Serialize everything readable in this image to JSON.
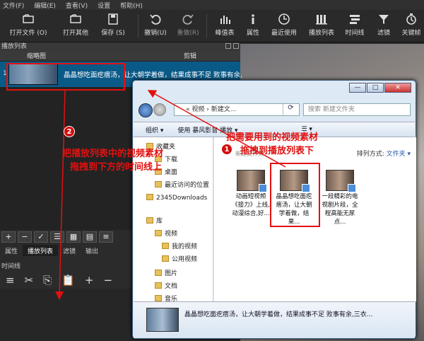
{
  "menu": [
    "文件(F)",
    "编辑(E)",
    "查看(V)",
    "设置",
    "帮助(H)"
  ],
  "toolbar": [
    {
      "label": "打开文件 (O)",
      "icon": "open-file-icon"
    },
    {
      "label": "打开其他",
      "icon": "open-other-icon"
    },
    {
      "label": "保存 (S)",
      "icon": "save-icon"
    },
    {
      "label": "撤销(U)",
      "icon": "undo-icon"
    },
    {
      "label": "重做(R)",
      "icon": "redo-icon"
    },
    {
      "label": "峰值表",
      "icon": "peak-meter-icon"
    },
    {
      "label": "属性",
      "icon": "properties-icon"
    },
    {
      "label": "最近使用",
      "icon": "recent-icon"
    },
    {
      "label": "播放列表",
      "icon": "playlist-icon"
    },
    {
      "label": "时间线",
      "icon": "timeline-icon"
    },
    {
      "label": "滤镜",
      "icon": "filter-icon"
    },
    {
      "label": "关键帧",
      "icon": "keyframe-icon"
    }
  ],
  "playlist": {
    "title": "播放列表",
    "col_thumb": "缩略图",
    "col_clip": "剪辑",
    "row_index": "1",
    "row_caption": "晶晶想吃面疙瘩汤，让大朝学着做，结果成事不足 败事有余,",
    "buttons": [
      "+",
      "−",
      "✓",
      "☰",
      "▦",
      "▤",
      "≡"
    ],
    "tabs": [
      "属性",
      "播放列表",
      "滤镜",
      "输出"
    ],
    "active_tab": "播放列表"
  },
  "timeline": {
    "title": "时间线",
    "buttons": [
      "≡",
      "✂",
      "⎘",
      "📋",
      "+",
      "−"
    ]
  },
  "explorer": {
    "win_ctrls": [
      "—",
      "□",
      "✕"
    ],
    "address": "«  视频  ›  新建文...",
    "search_placeholder": "搜索 新建文件夹",
    "cmd": [
      "组织 ▾",
      "使用 暴风影音 播放 ▾",
      "☰ ▾"
    ],
    "arrange_label": "排列方式:",
    "arrange_value": "文件夹 ▾",
    "content_sub": "新建文件夹",
    "nav": {
      "item_0": "收藏夹",
      "item_1": "下载",
      "item_2": "桌面",
      "item_3": "最近访问的位置",
      "item_4": "2345Downloads",
      "item_5": "库",
      "item_6": "视频",
      "item_7": "我的视频",
      "item_8": "公用视频",
      "item_9": "图片",
      "item_10": "文档",
      "item_11": "音乐"
    },
    "files": [
      {
        "name": "动画短视频《接力》上线,动漫综合,好..."
      },
      {
        "name": "晶晶想吃面疙瘩汤，让大朝学着做，结果..."
      },
      {
        "name": "一段精彩的电视剧片段，全程高能无尿点..."
      }
    ],
    "details_text": "晶晶想吃面疙瘩汤，让大朝学着做，结果成事不足 败事有余,三衣..."
  },
  "annotations": {
    "badge1": "1",
    "note1_a": "把需要用到的视频素材",
    "note1_b": "拖拽到播放列表下",
    "badge2": "2",
    "note2_a": "把播放列表中的视频素材",
    "note2_b": "拖拽到下方的时间线上",
    "color": "#e31010"
  }
}
